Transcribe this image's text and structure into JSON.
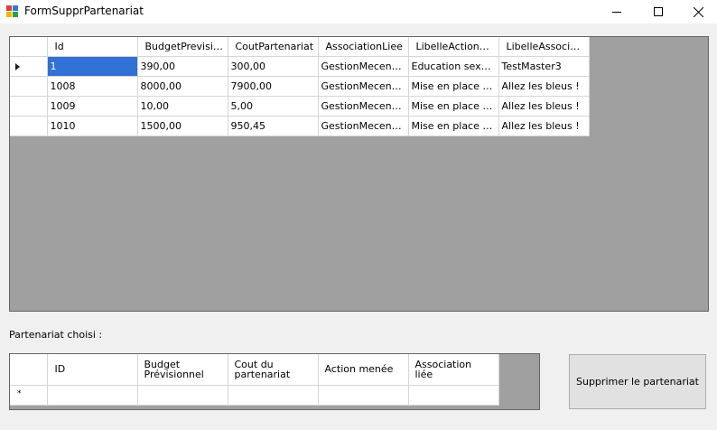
{
  "window": {
    "title": "FormSupprPartenariat"
  },
  "main_grid": {
    "columns": [
      "Id",
      "BudgetPrevisionnel",
      "CoutPartenariat",
      "AssociationLiee",
      "LibelleActionMenee",
      "LibelleAssociationLi"
    ],
    "rows": [
      [
        "1",
        "390,00",
        "300,00",
        "GestionMecenat...",
        "Education sexuelle",
        "TestMaster3"
      ],
      [
        "1008",
        "8000,00",
        "7900,00",
        "GestionMecenat...",
        "Mise en place d'é...",
        "Allez les bleus !"
      ],
      [
        "1009",
        "10,00",
        "5,00",
        "GestionMecenat...",
        "Mise en place d'é...",
        "Allez les bleus !"
      ],
      [
        "1010",
        "1500,00",
        "950,45",
        "GestionMecenat...",
        "Mise en place d'é...",
        "Allez les bleus !"
      ]
    ]
  },
  "chosen_label": "Partenariat choisi :",
  "chosen_grid": {
    "columns": [
      "ID",
      "Budget\nPrévisionnel",
      "Cout du\npartenariat",
      "Action menée",
      "Association\nliée"
    ],
    "new_row_marker": "*"
  },
  "delete_button": "Supprimer le partenariat"
}
